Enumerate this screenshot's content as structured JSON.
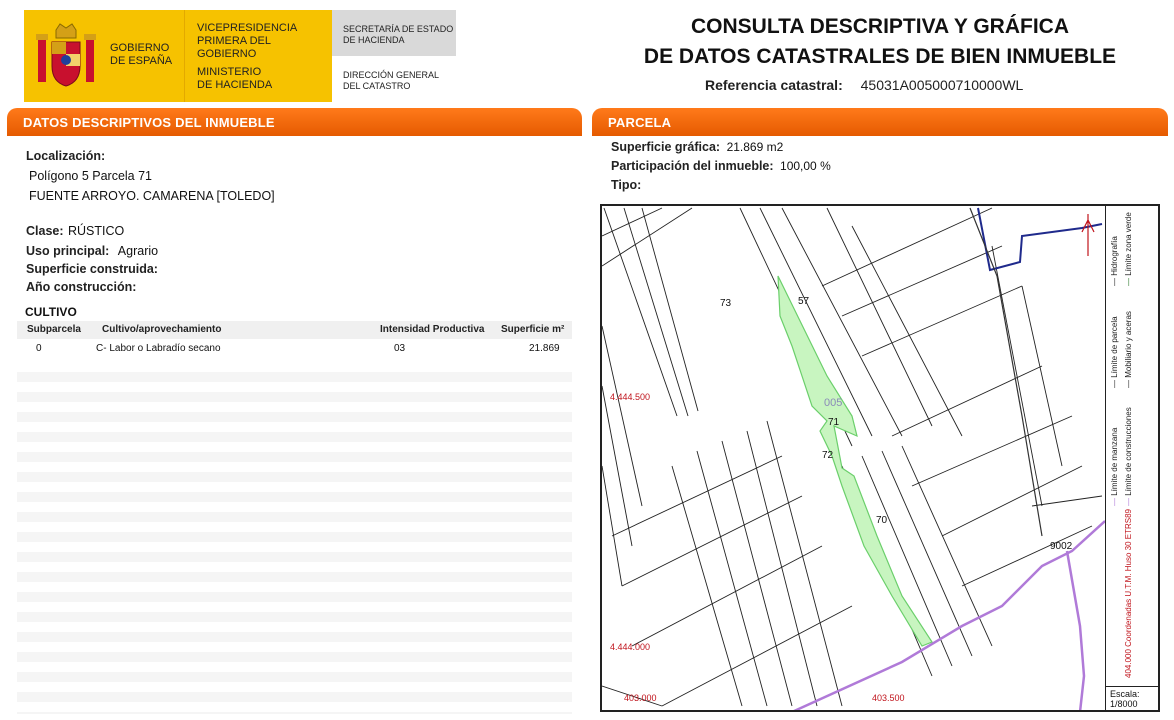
{
  "header": {
    "gobierno": [
      "GOBIERNO",
      "DE ESPAÑA"
    ],
    "vicepresidencia": [
      "VICEPRESIDENCIA",
      "PRIMERA DEL GOBIERNO"
    ],
    "ministerio": [
      "MINISTERIO",
      "DE HACIENDA"
    ],
    "secretaria": [
      "SECRETARÍA DE ESTADO",
      "DE HACIENDA"
    ],
    "direccion": [
      "DIRECCIÓN GENERAL",
      "DEL CATASTRO"
    ],
    "title_line1": "CONSULTA DESCRIPTIVA Y GRÁFICA",
    "title_line2": "DE DATOS CATASTRALES DE BIEN INMUEBLE",
    "ref_label": "Referencia catastral:",
    "ref_value": "45031A005000710000WL"
  },
  "left": {
    "section_title": "DATOS DESCRIPTIVOS DEL INMUEBLE",
    "localizacion_label": "Localización:",
    "localizacion_line1": "Polígono 5 Parcela 71",
    "localizacion_line2": "FUENTE ARROYO. CAMARENA [TOLEDO]",
    "clase_label": "Clase:",
    "clase_value": "RÚSTICO",
    "uso_label": "Uso principal:",
    "uso_value": "Agrario",
    "superficie_label": "Superficie construida:",
    "anio_label": "Año construcción:",
    "cultivo_title": "CULTIVO",
    "table_headers": [
      "Subparcela",
      "Cultivo/aprovechamiento",
      "Intensidad Productiva",
      "Superficie m²"
    ],
    "rows": [
      [
        "0",
        "C- Labor o Labradío secano",
        "03",
        "21.869"
      ]
    ]
  },
  "right": {
    "section_title": "PARCELA",
    "superficie_label": "Superficie gráfica:",
    "superficie_value": "21.869 m2",
    "participacion_label": "Participación del inmueble:",
    "participacion_value": "100,00 %",
    "tipo_label": "Tipo:"
  },
  "map": {
    "parcel_labels": [
      "73",
      "57",
      "005",
      "71",
      "72",
      "70",
      "9002"
    ],
    "coord_labels": [
      "4.444.500",
      "4.444.000",
      "403.000",
      "403.500"
    ],
    "legend": {
      "hidrografia": "Hidrografía",
      "zona_verde": "Límite zona verde",
      "parcela": "Límite de parcela",
      "mobiliario": "Mobiliario y aceras",
      "manzana": "Límite de manzana",
      "construcciones": "Límite de construcciones",
      "coords": "404.000 Coordenadas U.T.M. Huso 30 ETRS89"
    },
    "scale_label": "Escala:",
    "scale_value": "1/8000",
    "colors": {
      "parcel_fill": "#c8f5c0",
      "parcel_stroke": "#6bcf6b",
      "road": "#b07ad8",
      "hydro": "#1f2a8c",
      "coord_text": "#c0141c"
    }
  }
}
